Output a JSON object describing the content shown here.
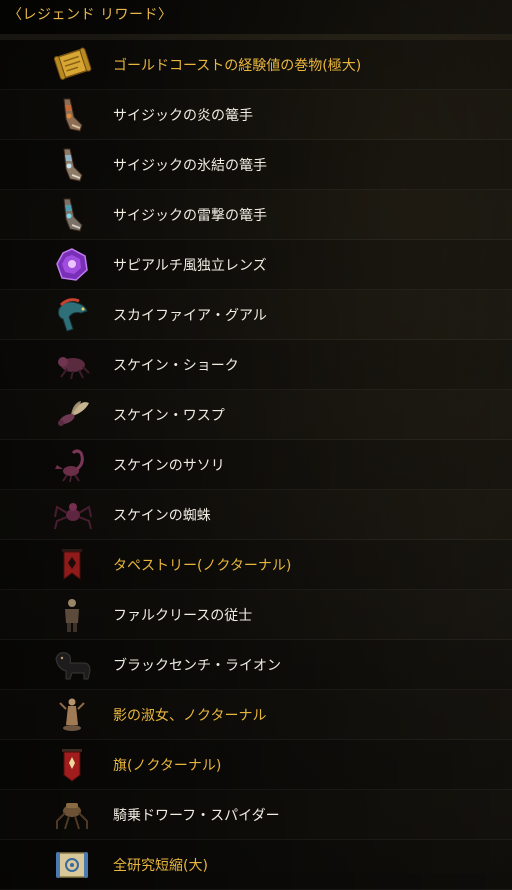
{
  "header": {
    "title": "〈レジェンド リワード〉"
  },
  "colors": {
    "accent_gold": "#e8b63c",
    "text_white": "#f0ece2"
  },
  "items": [
    {
      "label": "ゴールドコーストの経験値の巻物(極大)",
      "highlight": true,
      "icon": "scroll-icon"
    },
    {
      "label": "サイジックの炎の篭手",
      "highlight": false,
      "icon": "gauntlet-icon"
    },
    {
      "label": "サイジックの氷結の篭手",
      "highlight": false,
      "icon": "gauntlet-icon"
    },
    {
      "label": "サイジックの雷撃の篭手",
      "highlight": false,
      "icon": "gauntlet-icon"
    },
    {
      "label": "サピアルチ風独立レンズ",
      "highlight": false,
      "icon": "lens-icon"
    },
    {
      "label": "スカイファイア・グアル",
      "highlight": false,
      "icon": "guar-icon"
    },
    {
      "label": "スケイン・ショーク",
      "highlight": false,
      "icon": "shalk-icon"
    },
    {
      "label": "スケイン・ワスプ",
      "highlight": false,
      "icon": "wasp-icon"
    },
    {
      "label": "スケインのサソリ",
      "highlight": false,
      "icon": "scorpion-icon"
    },
    {
      "label": "スケインの蜘蛛",
      "highlight": false,
      "icon": "spider-icon"
    },
    {
      "label": "タペストリー(ノクターナル)",
      "highlight": true,
      "icon": "tapestry-icon"
    },
    {
      "label": "ファルクリースの従士",
      "highlight": false,
      "icon": "squire-icon"
    },
    {
      "label": "ブラックセンチ・ライオン",
      "highlight": false,
      "icon": "lion-icon"
    },
    {
      "label": "影の淑女、ノクターナル",
      "highlight": true,
      "icon": "statue-icon"
    },
    {
      "label": "旗(ノクターナル)",
      "highlight": true,
      "icon": "banner-icon"
    },
    {
      "label": "騎乗ドワーフ・スパイダー",
      "highlight": false,
      "icon": "dwarven-spider-icon"
    },
    {
      "label": "全研究短縮(大)",
      "highlight": true,
      "icon": "research-scroll-icon"
    }
  ]
}
